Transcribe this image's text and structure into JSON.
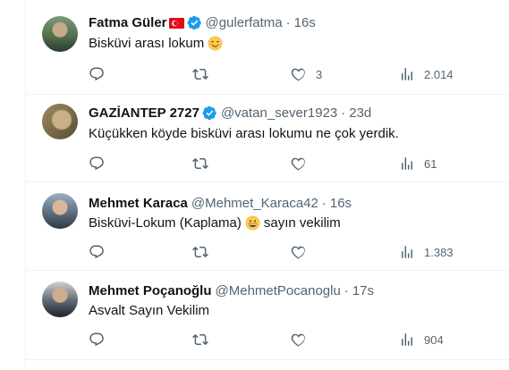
{
  "tweets": [
    {
      "name": "Fatma Güler",
      "handle": "@gulerfatma",
      "time": "16s",
      "text": "Bisküvi arası lokum",
      "emoji": "smiling-face-icon",
      "flag": "turkey-flag-icon",
      "verified": true,
      "replies": "",
      "retweets": "",
      "likes": "3",
      "views": "2.014"
    },
    {
      "name": "GAZİANTEP 2727",
      "handle": "@vatan_sever1923",
      "time": "23d",
      "text": "Küçükken köyde bisküvi arası lokumu ne çok yerdik.",
      "verified": true,
      "replies": "",
      "retweets": "",
      "likes": "",
      "views": "61"
    },
    {
      "name": "Mehmet Karaca",
      "handle": "@Mehmet_Karaca42",
      "time": "16s",
      "text_before": "Bisküvi-Lokum (Kaplama)",
      "text_after": "sayın vekilim",
      "emoji": "grinning-face-icon",
      "verified": false,
      "replies": "",
      "retweets": "",
      "likes": "",
      "views": "1.383"
    },
    {
      "name": "Mehmet Poçanoğlu",
      "handle": "@MehmetPocanoglu",
      "time": "17s",
      "text": "Asvalt Sayın Vekilim",
      "verified": false,
      "replies": "",
      "retweets": "",
      "likes": "",
      "views": "904"
    }
  ],
  "separator": "·",
  "colors": {
    "text": "#0f1419",
    "muted": "#536471",
    "verified": "#1d9bf0",
    "border": "#eff3f4",
    "flag_red": "#e30a17"
  }
}
